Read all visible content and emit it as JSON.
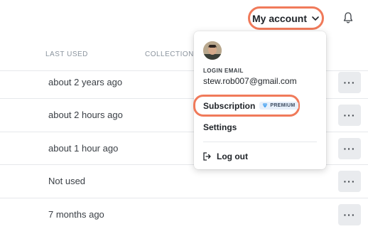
{
  "header": {
    "account_button_label": "My account",
    "chevron_icon": "chevron-down-icon",
    "bell_icon": "bell-icon"
  },
  "table": {
    "columns": [
      "LAST USED",
      "COLLECTIONS"
    ],
    "rows": [
      {
        "last_used": "about 2 years ago",
        "more": "···"
      },
      {
        "last_used": "about 2 hours ago",
        "more": "···"
      },
      {
        "last_used": "about 1 hour ago",
        "more": "···"
      },
      {
        "last_used": "Not used",
        "more": "···"
      },
      {
        "last_used": "7 months ago",
        "more": "···"
      }
    ]
  },
  "dropdown": {
    "login_label": "LOGIN EMAIL",
    "email": "stew.rob007@gmail.com",
    "subscription_label": "Subscription",
    "premium_badge": "PREMIUM",
    "settings_label": "Settings",
    "logout_label": "Log out"
  },
  "colors": {
    "highlight": "#f07a5a",
    "premium_bg": "#e7f0fb",
    "premium_gem": "#4aa3f0"
  }
}
